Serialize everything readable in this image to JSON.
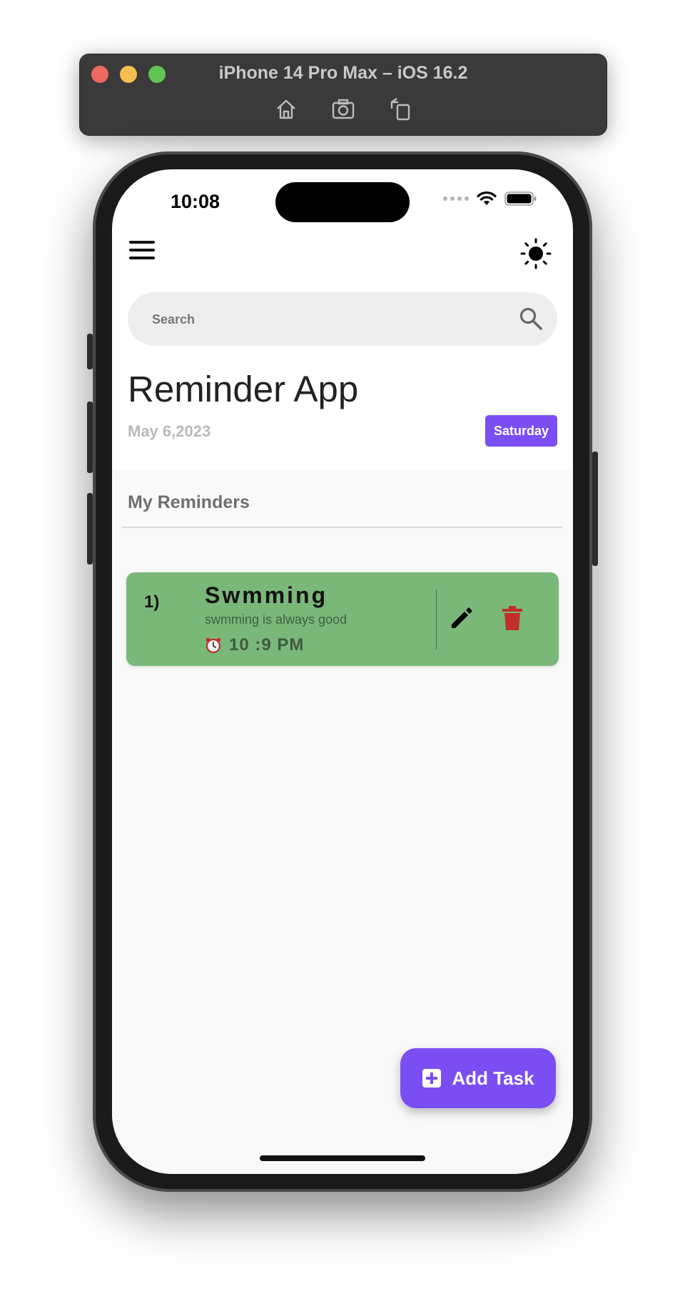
{
  "simulator": {
    "title": "iPhone 14 Pro Max – iOS 16.2",
    "toolbar_icons": [
      "home-icon",
      "screenshot-icon",
      "rotate-icon"
    ]
  },
  "status_bar": {
    "time": "10:08"
  },
  "header": {
    "menu_icon": "menu-icon",
    "theme_icon": "sun-icon"
  },
  "search": {
    "placeholder": "Search"
  },
  "app": {
    "title": "Reminder App",
    "date": "May 6,2023",
    "day": "Saturday"
  },
  "reminders": {
    "section_title": "My Reminders",
    "items": [
      {
        "number": "1)",
        "title": "Swmming",
        "description": "swmming is always good",
        "time": "10 :9 PM",
        "color": "#7ab87a"
      }
    ]
  },
  "fab": {
    "label": "Add Task"
  },
  "colors": {
    "accent": "#7a4ef3",
    "card": "#7ab87a",
    "delete": "#c0302a"
  }
}
